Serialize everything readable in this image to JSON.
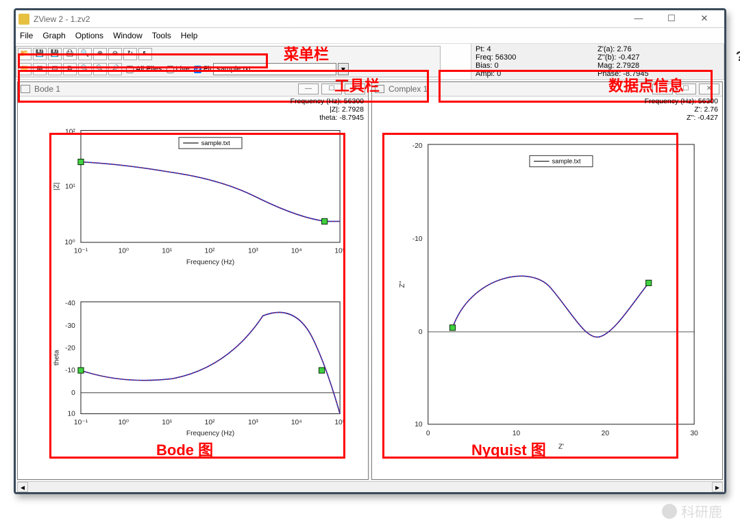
{
  "titlebar": {
    "title": "ZView 2 - 1.zv2"
  },
  "menu": [
    "File",
    "Graph",
    "Options",
    "Window",
    "Tools",
    "Help"
  ],
  "toolbar": {
    "checkboxes": {
      "allfiles": "All Files",
      "live": "Live",
      "fit": "Fit"
    },
    "file_field": "sample.txt"
  },
  "info": {
    "pt": "Pt: 4",
    "za": "Z'(a): 2.76",
    "freq": "Freq: 56300",
    "zb": "Z''(b): -0.427",
    "bias": "Bias: 0",
    "mag": "Mag: 2.7928",
    "ampl": "Ampl: 0",
    "phase": "Phase: -8.7945"
  },
  "bode": {
    "title": "Bode 1",
    "infostrip": [
      "Frequency (Hz): 56300",
      "|Z|: 2.7928",
      "theta: -8.7945"
    ],
    "legend": "sample.txt",
    "mag_xlabel": "Frequency (Hz)",
    "mag_ylabel": "|Z|",
    "phase_xlabel": "Frequency (Hz)",
    "phase_ylabel": "theta",
    "mag_xticks": [
      "10⁻¹",
      "10⁰",
      "10¹",
      "10²",
      "10³",
      "10⁴",
      "10⁵"
    ],
    "mag_yticks": [
      "10⁰",
      "10¹",
      "10²"
    ],
    "phase_xticks": [
      "10⁻¹",
      "10⁰",
      "10¹",
      "10²",
      "10³",
      "10⁴",
      "10⁵"
    ],
    "phase_yticks": [
      "-40",
      "-30",
      "-20",
      "-10",
      "0",
      "10"
    ]
  },
  "complex": {
    "title": "Complex 1",
    "infostrip": [
      "Frequency (Hz): 56300",
      "Z': 2.76",
      "Z'': -0.427"
    ],
    "legend": "sample.txt",
    "xlabel": "Z'",
    "ylabel": "Z''",
    "xticks": [
      "0",
      "10",
      "20",
      "30"
    ],
    "yticks": [
      "-20",
      "-10",
      "0",
      "10"
    ]
  },
  "annotations": {
    "menubar": "菜单栏",
    "toolbar": "工具栏",
    "datapoint": "数据点信息",
    "bode": "Bode 图",
    "nyquist": "Nyquist 图"
  },
  "watermark": "科研鹿"
}
